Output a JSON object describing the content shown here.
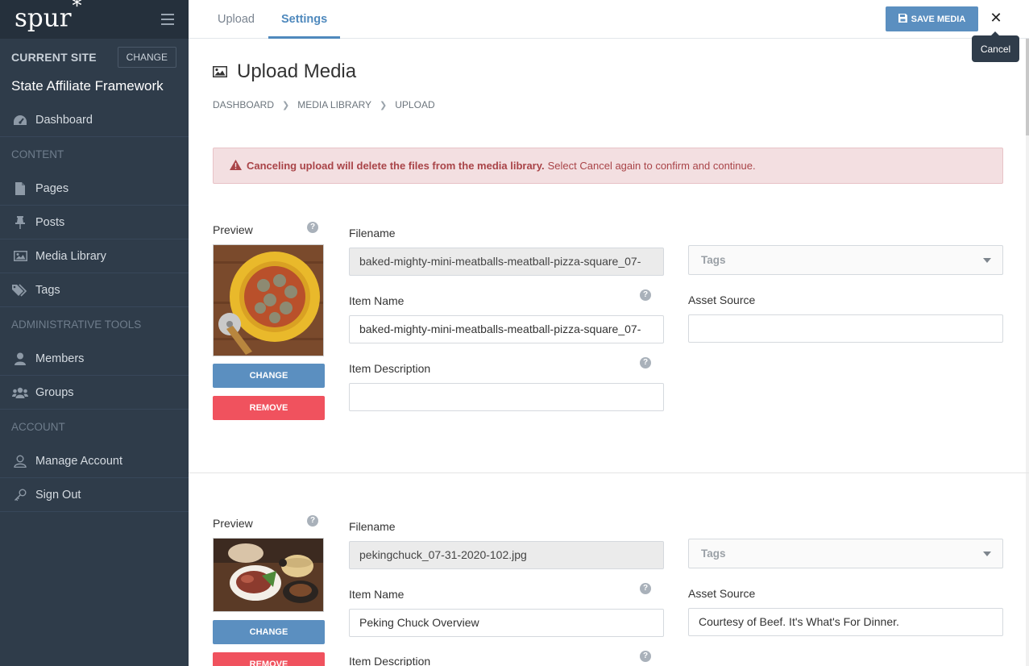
{
  "sidebar": {
    "logo": "spur",
    "logo_mark": "*",
    "current_site_label": "CURRENT SITE",
    "change_label": "CHANGE",
    "site_name": "State Affiliate Framework",
    "items": {
      "dashboard": "Dashboard",
      "content_section": "CONTENT",
      "pages": "Pages",
      "posts": "Posts",
      "media_library": "Media Library",
      "tags": "Tags",
      "admin_section": "ADMINISTRATIVE TOOLS",
      "members": "Members",
      "groups": "Groups",
      "account_section": "ACCOUNT",
      "manage_account": "Manage Account",
      "sign_out": "Sign Out"
    }
  },
  "topbar": {
    "tabs": [
      "Upload",
      "Settings"
    ],
    "active_tab": "Settings",
    "save_label": "SAVE MEDIA",
    "close_symbol": "✕",
    "tooltip": "Cancel"
  },
  "page": {
    "title": "Upload Media",
    "breadcrumb": [
      "DASHBOARD",
      "MEDIA LIBRARY",
      "UPLOAD"
    ],
    "alert_bold": "Canceling upload will delete the files from the media library.",
    "alert_text": "Select Cancel again to confirm and continue."
  },
  "labels": {
    "preview": "Preview",
    "filename": "Filename",
    "item_name": "Item Name",
    "item_description": "Item Description",
    "asset_source": "Asset Source",
    "tags_placeholder": "Tags",
    "change_button": "CHANGE",
    "remove_button": "REMOVE",
    "help_symbol": "?"
  },
  "media": [
    {
      "filename": "baked-mighty-mini-meatballs-meatball-pizza-square_07-",
      "item_name": "baked-mighty-mini-meatballs-meatball-pizza-square_07-",
      "item_description": "",
      "asset_source": ""
    },
    {
      "filename": "pekingchuck_07-31-2020-102.jpg",
      "item_name": "Peking Chuck Overview",
      "item_description": "",
      "asset_source": "Courtesy of Beef. It's What's For Dinner."
    }
  ],
  "colors": {
    "sidebar_bg": "#2f3c4a",
    "accent": "#5b8fc0",
    "danger": "#f0525e",
    "alert_bg": "#f3dfe1"
  }
}
